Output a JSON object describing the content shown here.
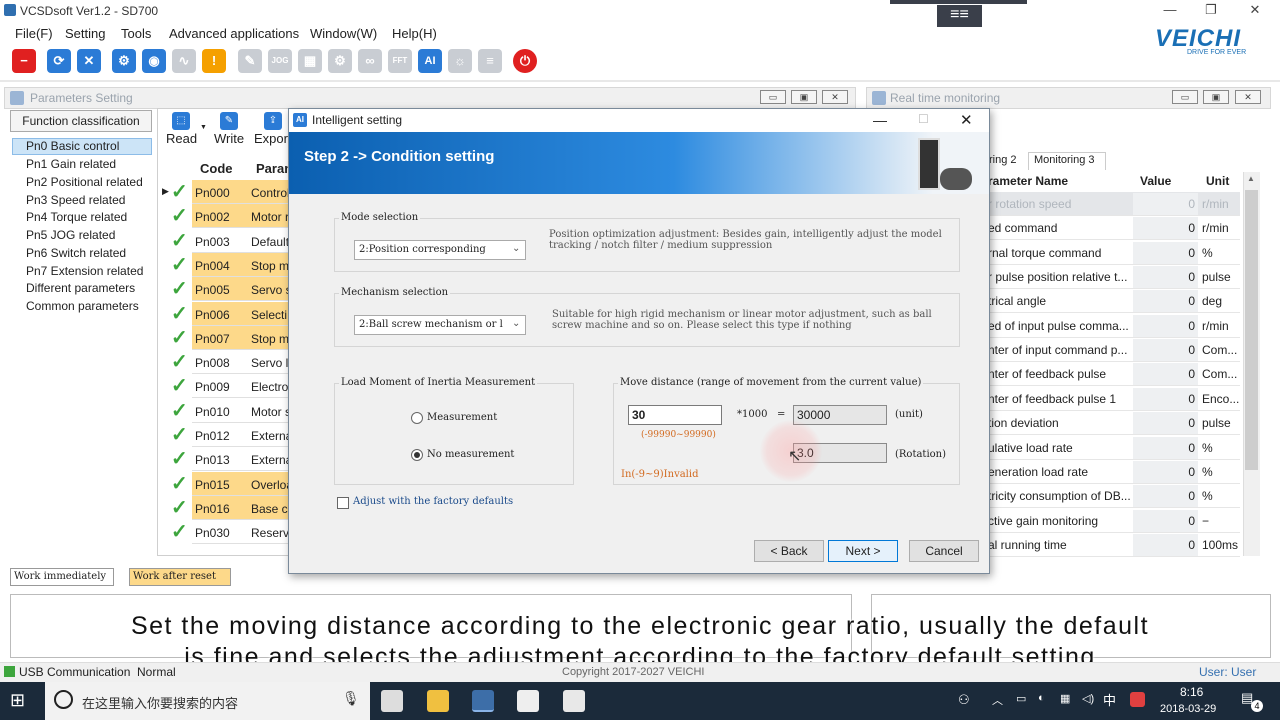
{
  "app": {
    "title": "VCSDsoft Ver1.2 - SD700",
    "min": "—",
    "max": "❐",
    "close": "✕",
    "burger": "≡≡"
  },
  "menu": [
    "File(F)",
    "Setting",
    "Tools",
    "Advanced applications",
    "Window(W)",
    "Help(H)"
  ],
  "logo": {
    "name": "VEICHI",
    "tagline": "DRIVE FOR EVER"
  },
  "toolbar": {
    "jog": "JOG",
    "fft": "FFT",
    "ai": "AI"
  },
  "params_panel": {
    "title": "Parameters Setting",
    "function_classification": "Function classification",
    "categories": [
      "Pn0 Basic control",
      "Pn1 Gain related",
      "Pn2 Positional related",
      "Pn3 Speed related",
      "Pn4 Torque related",
      "Pn5 JOG related",
      "Pn6 Switch related",
      "Pn7 Extension related",
      "Different parameters",
      "Common parameters"
    ],
    "read": "Read",
    "write": "Write",
    "export": "Expor",
    "col_code": "Code",
    "col_param": "Param",
    "rows": [
      {
        "code": "Pn000",
        "name": "Control"
      },
      {
        "code": "Pn002",
        "name": "Motor r"
      },
      {
        "code": "Pn003",
        "name": "Default"
      },
      {
        "code": "Pn004",
        "name": "Stop m"
      },
      {
        "code": "Pn005",
        "name": "Servo s"
      },
      {
        "code": "Pn006",
        "name": "Selecti"
      },
      {
        "code": "Pn007",
        "name": "Stop m"
      },
      {
        "code": "Pn008",
        "name": "Servo l"
      },
      {
        "code": "Pn009",
        "name": "Electro"
      },
      {
        "code": "Pn010",
        "name": "Motor s"
      },
      {
        "code": "Pn012",
        "name": "Externa"
      },
      {
        "code": "Pn013",
        "name": "Externa"
      },
      {
        "code": "Pn015",
        "name": "Overloa"
      },
      {
        "code": "Pn016",
        "name": "Base cu"
      },
      {
        "code": "Pn030",
        "name": "Reserve"
      }
    ],
    "work_immediately": "Work immediately",
    "work_after_reset": "Work after reset"
  },
  "rt_panel": {
    "title": "Real time monitoring",
    "tabs": [
      "ring 2",
      "Monitoring 3"
    ],
    "col_name": "rameter Name",
    "col_value": "Value",
    "col_unit": "Unit",
    "rows": [
      {
        "name": "r rotation speed",
        "value": "0",
        "unit": "r/min"
      },
      {
        "name": "ed command",
        "value": "0",
        "unit": "r/min"
      },
      {
        "name": "rnal torque command",
        "value": "0",
        "unit": "%"
      },
      {
        "name": "r pulse position relative t...",
        "value": "0",
        "unit": "pulse"
      },
      {
        "name": "trical angle",
        "value": "0",
        "unit": "deg"
      },
      {
        "name": "ed of input pulse comma...",
        "value": "0",
        "unit": "r/min"
      },
      {
        "name": "nter of input command p...",
        "value": "0",
        "unit": "Com..."
      },
      {
        "name": "nter of feedback pulse",
        "value": "0",
        "unit": "Com..."
      },
      {
        "name": "nter of feedback pulse 1",
        "value": "0",
        "unit": "Enco..."
      },
      {
        "name": "tion deviation",
        "value": "0",
        "unit": "pulse"
      },
      {
        "name": "ulative load rate",
        "value": "0",
        "unit": "%"
      },
      {
        "name": "eneration load rate",
        "value": "0",
        "unit": "%"
      },
      {
        "name": "tricity consumption of DB...",
        "value": "0",
        "unit": "%"
      },
      {
        "name": "ctive gain monitoring",
        "value": "0",
        "unit": "−"
      },
      {
        "name": "al running time",
        "value": "0",
        "unit": "100ms"
      }
    ]
  },
  "dialog": {
    "title": "Intelligent setting",
    "icon": "AI",
    "step": "Step 2 -> Condition setting",
    "mode_label": "Mode selection",
    "mode_value": "2:Position corresponding",
    "mode_desc": "Position optimization adjustment: Besides gain, intelligently adjust the model tracking / notch filter / medium suppression",
    "mech_label": "Mechanism selection",
    "mech_value": "2:Ball screw mechanism or l",
    "mech_desc": "Suitable for high rigid mechanism or linear motor adjustment, such as ball screw machine and so on. Please select this type if nothing",
    "inertia_label": "Load Moment of Inertia Measurement",
    "measurement": "Measurement",
    "no_measurement": "No measurement",
    "move_label": "Move distance (range of movement from the current value)",
    "move_value": "30",
    "move_range": "(-99990~99990)",
    "multiplier": "*1000",
    "equals": "=",
    "unit_value": "30000",
    "unit_label": "(unit)",
    "rotation_value": "3.0",
    "rotation_label": "(Rotation)",
    "invalid_hint": "In(-9~9)Invalid",
    "factory_defaults": "Adjust with the factory defaults",
    "back": "< Back",
    "next": "Next >",
    "cancel": "Cancel"
  },
  "subtitles": {
    "line1": "Set the moving distance according to the electronic gear ratio, usually the default",
    "line2": "is fine and selects the adjustment according to the factory default setting"
  },
  "status": {
    "connection": "USB Communication",
    "state": "Normal",
    "copyright": "Copyright 2017-2027 VEICHI",
    "user": "User: User"
  },
  "taskbar": {
    "search_placeholder": "在这里输入你要搜索的内容",
    "time": "8:16",
    "date": "2018-03-29",
    "ime": "中",
    "notif": "4"
  }
}
